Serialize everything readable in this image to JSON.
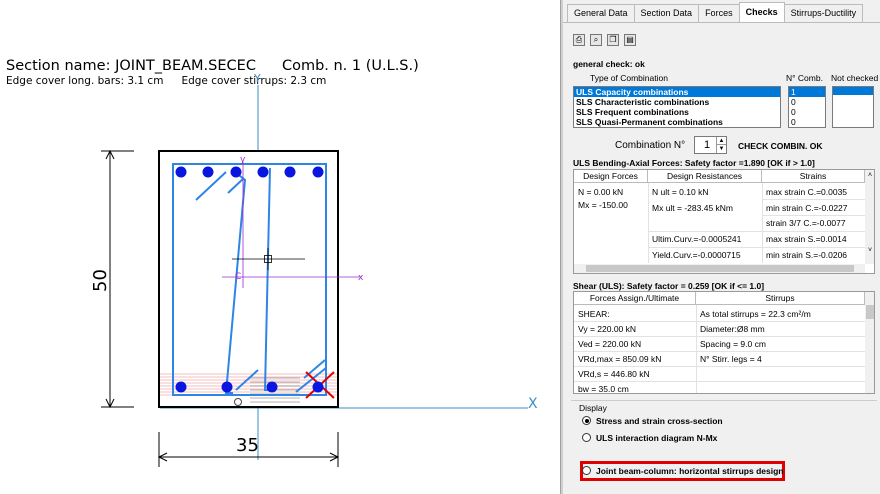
{
  "section": {
    "title": "Section name: JOINT_BEAM.SECEC",
    "combination": "Comb. n. 1 (U.L.S.)",
    "edge_cover_long": "Edge cover long. bars: 3.1 cm",
    "edge_cover_stirrups": "Edge cover stirrups: 2.3 cm",
    "height_label": "50",
    "width_label": "35",
    "axis_y": "Y",
    "axis_x": "X",
    "local_y": "y",
    "local_x": "x",
    "centroid": "C"
  },
  "tabs": [
    "General Data",
    "Section Data",
    "Forces",
    "Checks",
    "Stirrups-Ductility"
  ],
  "active_tab": "Checks",
  "checks": {
    "general_check": "general check: ok",
    "col_type": "Type of Combination",
    "col_ncomb": "N° Comb.",
    "col_notchecked": "Not checked",
    "combinations": [
      {
        "name": "ULS Capacity combinations",
        "n": "1"
      },
      {
        "name": "SLS Characteristic combinations",
        "n": "0"
      },
      {
        "name": "SLS Frequent combinations",
        "n": "0"
      },
      {
        "name": "SLS Quasi-Permanent combinations",
        "n": "0"
      }
    ],
    "combination_label": "Combination N°",
    "combination_value": "1",
    "check_status": "CHECK COMBIN. OK"
  },
  "bending": {
    "title": "ULS Bending-Axial Forces: Safety factor =1.890 [OK if > 1.0]",
    "headers": [
      "Design Forces",
      "Design Resistances",
      "Strains"
    ],
    "forces": [
      "N  = 0.00 kN",
      "Mx  = -150.00"
    ],
    "resistances": [
      "N ult  = 0.10 kN",
      "Mx ult = -283.45 kNm",
      "",
      "Ultim.Curv.=-0.0005241",
      "Yield.Curv.=-0.0000715"
    ],
    "strains": [
      "max strain C.=0.0035",
      "min strain C.=-0.0227",
      "strain 3/7 C.=-0.0077",
      "max strain S.=0.0014",
      "min strain S.=-0.0206"
    ]
  },
  "shear": {
    "title": "Shear (ULS): Safety factor = 0.259 [OK if <= 1.0]",
    "headers": [
      "Forces Assign./Ultimate",
      "Stirrups"
    ],
    "forces": [
      "SHEAR:",
      "Vy  = 220.00 kN",
      "Ved  = 220.00 kN",
      "VRd,max  = 850.09 kN",
      "VRd,s = 446.80 kN",
      "bw  = 35.0 cm"
    ],
    "stirrups": [
      "As total stirrups = 22.3 cm²/m",
      "Diameter:Ø8 mm",
      "Spacing = 9.0 cm",
      "N° Stirr. legs = 4",
      "",
      ""
    ]
  },
  "display": {
    "title": "Display",
    "options": [
      "Stress and strain cross-section",
      "ULS interaction diagram N-Mx",
      "Joint beam-column:  horizontal stirrups design"
    ],
    "selected": 0
  },
  "colors": {
    "axis": "#3a8fc4",
    "section_fill": "#ffffff",
    "bar": "#0a16e0",
    "stirrup": "#2d86e6",
    "local_axis": "#9a2bd0",
    "stress": "#e05050",
    "highlight": "#e00000",
    "selection": "#0078d7"
  },
  "icons": [
    "print-icon",
    "preview-icon",
    "copy-icon",
    "report-icon"
  ]
}
